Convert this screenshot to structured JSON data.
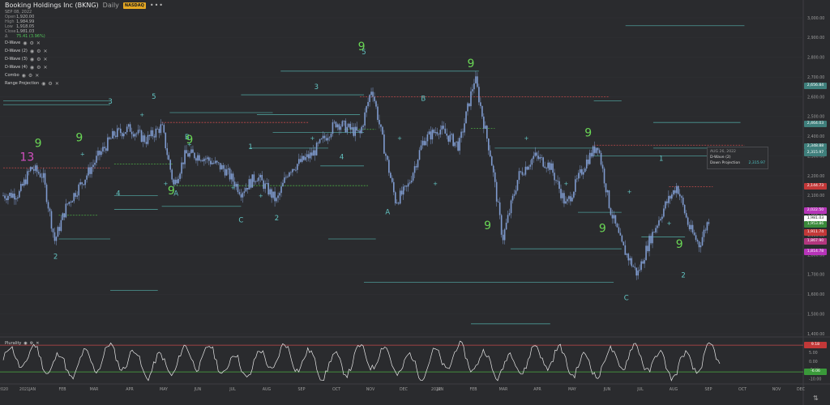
{
  "header": {
    "title": "Booking Holdings Inc (BKNG)",
    "interval": "Daily",
    "exchange": "NASDAQ",
    "more": "•••",
    "date": "SEP 08, 2022",
    "ohlc": [
      {
        "k": "Open",
        "v": "1,920.00"
      },
      {
        "k": "High",
        "v": "1,984.99"
      },
      {
        "k": "Low",
        "v": "1,918.05"
      },
      {
        "k": "Close",
        "v": "1,981.03"
      }
    ],
    "change": "75.41 (3.96%)"
  },
  "studies": [
    {
      "name": "D-Wave"
    },
    {
      "name": "D-Wave (2)"
    },
    {
      "name": "D-Wave (3)"
    },
    {
      "name": "D-Wave (4)"
    },
    {
      "name": "Combo"
    },
    {
      "name": "Range Projection"
    }
  ],
  "tooltip": {
    "date": "AUG 26, 2022",
    "row1": "D-Wave (2)",
    "row2_k": "Down Projection",
    "row2_v": "2,315.97"
  },
  "plurality": {
    "label": "Plurality"
  },
  "colors": {
    "background": "#2a2b2e",
    "candle": "#7f9bcf",
    "wave_label": "#63c5c3",
    "count_green": "#6ad655",
    "count_pink": "#d34fc0",
    "projection_line": "#4c9a96",
    "resistance": "#c24a4a",
    "support_green": "#4cab43"
  },
  "price_labels": [
    {
      "text": "2,656.84",
      "bg": "#3f7f7c",
      "price": 2657
    },
    {
      "text": "2,464.03",
      "bg": "#3f7f7c",
      "price": 2464
    },
    {
      "text": "2,348.88",
      "bg": "#3f7f7c",
      "price": 2349
    },
    {
      "text": "2,315.97",
      "bg": "#3f7f7c",
      "price": 2316
    },
    {
      "text": "2,144.73",
      "bg": "#c23838",
      "price": 2145
    },
    {
      "text": "2,022.50",
      "bg": "#b734b9",
      "price": 2022
    },
    {
      "text": "1,981.03",
      "bg": "#ffffff",
      "price": 1981,
      "fg": "#111111"
    },
    {
      "text": "1,953.86",
      "bg": "#3a8a3a",
      "price": 1954
    },
    {
      "text": "1,911.74",
      "bg": "#c23838",
      "price": 1912
    },
    {
      "text": "1,867.90",
      "bg": "#b2367e",
      "price": 1868
    },
    {
      "text": "1,814.78",
      "bg": "#b734b9",
      "price": 1815
    }
  ],
  "chart_data": {
    "type": "candlestick",
    "title": "Booking Holdings Inc (BKNG) Daily",
    "y_ticks": [
      "3,000.00",
      "2,900.00",
      "2,800.00",
      "2,700.00",
      "2,600.00",
      "2,500.00",
      "2,400.00",
      "2,300.00",
      "2,200.00",
      "2,100.00",
      "2,000.00",
      "1,900.00",
      "1,800.00",
      "1,700.00",
      "1,600.00",
      "1,500.00",
      "1,400.00"
    ],
    "ylim": [
      1400,
      3000
    ],
    "x_ticks": [
      "2020",
      "2021",
      "JAN",
      "FEB",
      "MAR",
      "APR",
      "MAY",
      "JUN",
      "JUL",
      "AUG",
      "SEP",
      "OCT",
      "NOV",
      "DEC",
      "2022",
      "JAN",
      "FEB",
      "MAR",
      "APR",
      "MAY",
      "JUN",
      "JUL",
      "AUG",
      "SEP",
      "OCT",
      "NOV",
      "DEC"
    ],
    "approx_close_path": [
      {
        "x": 0.0,
        "y": 2100
      },
      {
        "x": 0.02,
        "y": 2110
      },
      {
        "x": 0.035,
        "y": 2240
      },
      {
        "x": 0.05,
        "y": 2200
      },
      {
        "x": 0.065,
        "y": 1870
      },
      {
        "x": 0.08,
        "y": 2050
      },
      {
        "x": 0.1,
        "y": 2170
      },
      {
        "x": 0.12,
        "y": 2300
      },
      {
        "x": 0.14,
        "y": 2410
      },
      {
        "x": 0.16,
        "y": 2440
      },
      {
        "x": 0.18,
        "y": 2380
      },
      {
        "x": 0.2,
        "y": 2450
      },
      {
        "x": 0.215,
        "y": 2150
      },
      {
        "x": 0.23,
        "y": 2310
      },
      {
        "x": 0.25,
        "y": 2300
      },
      {
        "x": 0.28,
        "y": 2230
      },
      {
        "x": 0.3,
        "y": 2120
      },
      {
        "x": 0.32,
        "y": 2200
      },
      {
        "x": 0.345,
        "y": 2070
      },
      {
        "x": 0.36,
        "y": 2230
      },
      {
        "x": 0.39,
        "y": 2310
      },
      {
        "x": 0.42,
        "y": 2470
      },
      {
        "x": 0.45,
        "y": 2410
      },
      {
        "x": 0.465,
        "y": 2650
      },
      {
        "x": 0.48,
        "y": 2350
      },
      {
        "x": 0.495,
        "y": 2070
      },
      {
        "x": 0.51,
        "y": 2140
      },
      {
        "x": 0.53,
        "y": 2380
      },
      {
        "x": 0.55,
        "y": 2440
      },
      {
        "x": 0.575,
        "y": 2350
      },
      {
        "x": 0.595,
        "y": 2700
      },
      {
        "x": 0.605,
        "y": 2490
      },
      {
        "x": 0.615,
        "y": 2300
      },
      {
        "x": 0.63,
        "y": 1880
      },
      {
        "x": 0.65,
        "y": 2200
      },
      {
        "x": 0.67,
        "y": 2300
      },
      {
        "x": 0.69,
        "y": 2250
      },
      {
        "x": 0.71,
        "y": 2050
      },
      {
        "x": 0.735,
        "y": 2270
      },
      {
        "x": 0.75,
        "y": 2360
      },
      {
        "x": 0.765,
        "y": 2040
      },
      {
        "x": 0.78,
        "y": 1850
      },
      {
        "x": 0.8,
        "y": 1700
      },
      {
        "x": 0.815,
        "y": 1870
      },
      {
        "x": 0.835,
        "y": 2050
      },
      {
        "x": 0.85,
        "y": 2150
      },
      {
        "x": 0.865,
        "y": 1940
      },
      {
        "x": 0.878,
        "y": 1850
      },
      {
        "x": 0.89,
        "y": 1981
      }
    ],
    "annotations": [
      {
        "text": "2",
        "price": 1780,
        "x": 0.066,
        "kind": "wave"
      },
      {
        "text": "3",
        "price": 2565,
        "x": 0.135,
        "kind": "wave"
      },
      {
        "text": "5",
        "price": 2590,
        "x": 0.19,
        "kind": "wave"
      },
      {
        "text": "4",
        "price": 2100,
        "x": 0.145,
        "kind": "wave"
      },
      {
        "text": "A",
        "price": 2100,
        "x": 0.218,
        "kind": "wave"
      },
      {
        "text": "B",
        "price": 2385,
        "x": 0.232,
        "kind": "wave"
      },
      {
        "text": "1",
        "price": 2335,
        "x": 0.312,
        "kind": "wave"
      },
      {
        "text": "C",
        "price": 1965,
        "x": 0.3,
        "kind": "wave"
      },
      {
        "text": "2",
        "price": 1975,
        "x": 0.345,
        "kind": "wave"
      },
      {
        "text": "3",
        "price": 2640,
        "x": 0.395,
        "kind": "wave"
      },
      {
        "text": "4",
        "price": 2285,
        "x": 0.427,
        "kind": "wave"
      },
      {
        "text": "5",
        "price": 2815,
        "x": 0.455,
        "kind": "wave"
      },
      {
        "text": "A",
        "price": 2005,
        "x": 0.485,
        "kind": "wave"
      },
      {
        "text": "B",
        "price": 2580,
        "x": 0.53,
        "kind": "wave"
      },
      {
        "text": "C",
        "price": 1570,
        "x": 0.786,
        "kind": "wave"
      },
      {
        "text": "1",
        "price": 2275,
        "x": 0.83,
        "kind": "wave"
      },
      {
        "text": "2",
        "price": 1685,
        "x": 0.858,
        "kind": "wave"
      },
      {
        "text": "13",
        "price": 2275,
        "x": 0.03,
        "kind": "pink"
      },
      {
        "text": "9",
        "price": 2345,
        "x": 0.044,
        "kind": "green"
      },
      {
        "text": "9",
        "price": 2375,
        "x": 0.096,
        "kind": "green"
      },
      {
        "text": "9",
        "price": 2365,
        "x": 0.235,
        "kind": "green"
      },
      {
        "text": "9",
        "price": 2105,
        "x": 0.212,
        "kind": "green"
      },
      {
        "text": "9",
        "price": 2835,
        "x": 0.452,
        "kind": "green"
      },
      {
        "text": "9",
        "price": 2750,
        "x": 0.59,
        "kind": "green"
      },
      {
        "text": "9",
        "price": 1930,
        "x": 0.611,
        "kind": "green"
      },
      {
        "text": "9",
        "price": 2400,
        "x": 0.738,
        "kind": "green"
      },
      {
        "text": "9",
        "price": 1915,
        "x": 0.756,
        "kind": "green"
      },
      {
        "text": "9",
        "price": 1835,
        "x": 0.853,
        "kind": "green"
      }
    ]
  },
  "plurality_axis": [
    "10.00",
    "5.00",
    "0.00",
    "-5.00",
    "-10.00"
  ],
  "plurality_labels": [
    {
      "text": "9.18",
      "bg": "#c23838",
      "value": 9.18
    },
    {
      "text": "-6.06",
      "bg": "#3a9a3a",
      "value": -6.06
    }
  ]
}
